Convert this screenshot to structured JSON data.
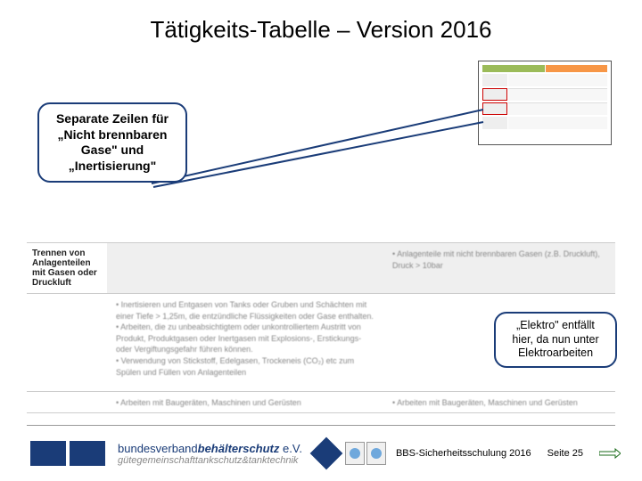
{
  "title": "Tätigkeits-Tabelle – Version 2016",
  "callouts": {
    "left": "Separate  Zeilen für „Nicht brennbaren Gase\" und „Inertisierung\"",
    "right": "„Elektro\" entfällt hier, da nun unter Elektroarbeiten"
  },
  "table": {
    "header_left": "Trennen von Anlagenteilen mit Gasen oder Druckluft",
    "body_left_items": [
      "Inertisieren und Entgasen von Tanks oder Gruben und Schächten mit einer Tiefe > 1,25m, die entzündliche Flüssigkeiten oder Gase enthalten.",
      "Arbeiten, die zu unbeabsichtigtem oder unkontrolliertem Austritt von Produkt, Produktgasen oder Inertgasen mit Explosions-, Erstickungs- oder Vergiftungsgefahr führen können.",
      "Verwendung von Stickstoff, Edelgasen, Trockeneis (CO₂) etc zum Spülen und Füllen von Anlagenteilen"
    ],
    "right_top": "Anlagenteile mit nicht brennbaren Gasen (z.B. Druckluft), Druck > 10bar",
    "bottom_items": "Arbeiten mit Baugeräten, Maschinen und Gerüsten"
  },
  "footer": {
    "org_line1_prefix": "bundesverband",
    "org_line1_bold": "behälterschutz",
    "org_line1_suffix": "e.V.",
    "org_line2": "gütegemeinschafttankschutz&tanktechnik",
    "training": "BBS-Sicherheitsschulung 2016",
    "page_label": "Seite 25"
  }
}
